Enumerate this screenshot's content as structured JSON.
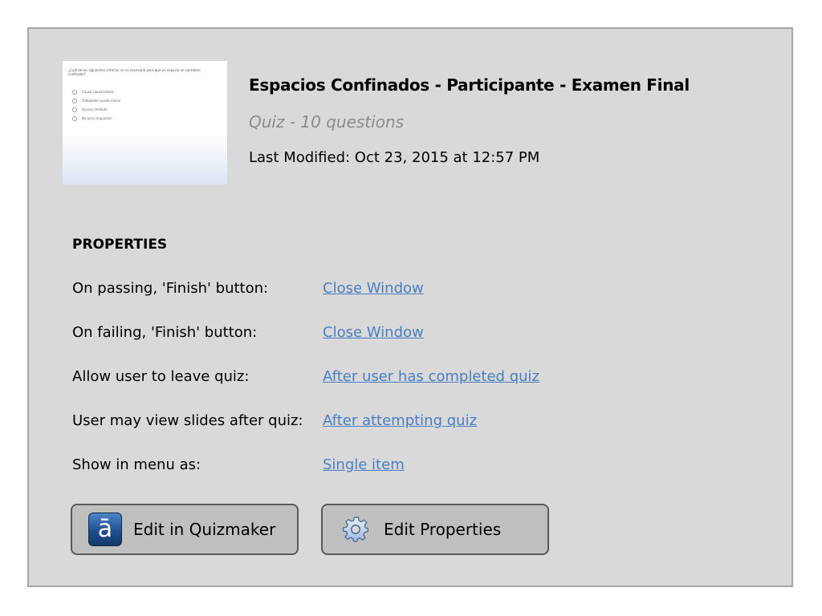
{
  "thumbnail": {
    "question": "¿Cuál de los siguientes criterios no es necesario para que un espacio se considere confinado?",
    "options": [
      "Causa claustrofobia",
      "Trabajador puede entrar",
      "Acceso limitado",
      "No para ocupación"
    ]
  },
  "quiz": {
    "title": "Espacios Confinados - Participante - Examen Final",
    "subtitle": "Quiz - 10 questions",
    "last_modified": "Last Modified: Oct 23, 2015 at 12:57 PM"
  },
  "properties": {
    "heading": "PROPERTIES",
    "rows": [
      {
        "label": "On passing, 'Finish' button:",
        "value": "Close Window"
      },
      {
        "label": "On failing, 'Finish' button:",
        "value": "Close Window"
      },
      {
        "label": "Allow user to leave quiz:",
        "value": "After user has completed quiz"
      },
      {
        "label": "User may view slides after quiz:",
        "value": "After attempting quiz"
      },
      {
        "label": "Show in menu as:",
        "value": "Single item"
      }
    ]
  },
  "buttons": {
    "edit_quizmaker": {
      "label": "Edit in Quizmaker",
      "icon": "quizmaker-icon",
      "icon_glyph": "ā"
    },
    "edit_properties": {
      "label": "Edit Properties",
      "icon": "gear-icon"
    }
  },
  "colors": {
    "panel_bg": "#d9d9d9",
    "link": "#4a7ec2",
    "button_bg": "#bfbfbf",
    "button_border": "#5a5a5a"
  }
}
